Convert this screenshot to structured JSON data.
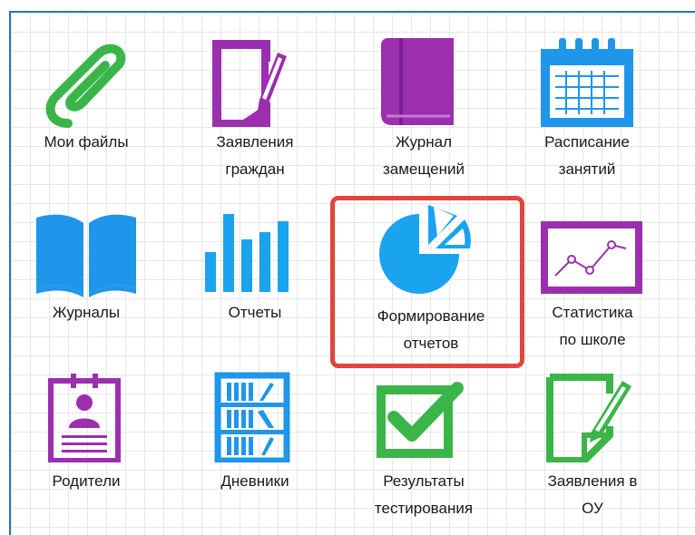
{
  "tiles": [
    {
      "id": "my-files",
      "icon": "paperclip-icon",
      "lines": [
        "Мои файлы"
      ],
      "color": "#3bb54a"
    },
    {
      "id": "citizen-applications",
      "icon": "document-pen-icon",
      "lines": [
        "Заявления",
        "граждан"
      ],
      "color": "#9b2fae"
    },
    {
      "id": "substitution-journal",
      "icon": "book-icon",
      "lines": [
        "Журнал",
        "замещений"
      ],
      "color": "#9b2fae"
    },
    {
      "id": "class-schedule",
      "icon": "calendar-icon",
      "lines": [
        "Расписание",
        "занятий"
      ],
      "color": "#1f96e9"
    },
    {
      "id": "journals",
      "icon": "open-book-icon",
      "lines": [
        "Журналы"
      ],
      "color": "#1f96e9"
    },
    {
      "id": "reports",
      "icon": "bar-chart-icon",
      "lines": [
        "Отчеты"
      ],
      "color": "#1aa3ef"
    },
    {
      "id": "report-generation",
      "icon": "pie-chart-icon",
      "lines": [
        "Формирование",
        "отчетов"
      ],
      "color": "#1aa3ef"
    },
    {
      "id": "school-statistics",
      "icon": "line-chart-icon",
      "lines": [
        "Статистика",
        "по школе"
      ],
      "color": "#9b2fae"
    },
    {
      "id": "parents",
      "icon": "user-card-icon",
      "lines": [
        "Родители"
      ],
      "color": "#9b2fae"
    },
    {
      "id": "diaries",
      "icon": "bookshelf-icon",
      "lines": [
        "Дневники"
      ],
      "color": "#1f96e9"
    },
    {
      "id": "test-results",
      "icon": "checkbox-icon",
      "lines": [
        "Результаты",
        "тестирования"
      ],
      "color": "#3bb54a"
    },
    {
      "id": "ou-applications",
      "icon": "document-pencil-icon",
      "lines": [
        "Заявления в",
        "ОУ"
      ],
      "color": "#3bb54a"
    }
  ],
  "highlight_color": "#e2453c",
  "highlighted_tile": "report-generation"
}
